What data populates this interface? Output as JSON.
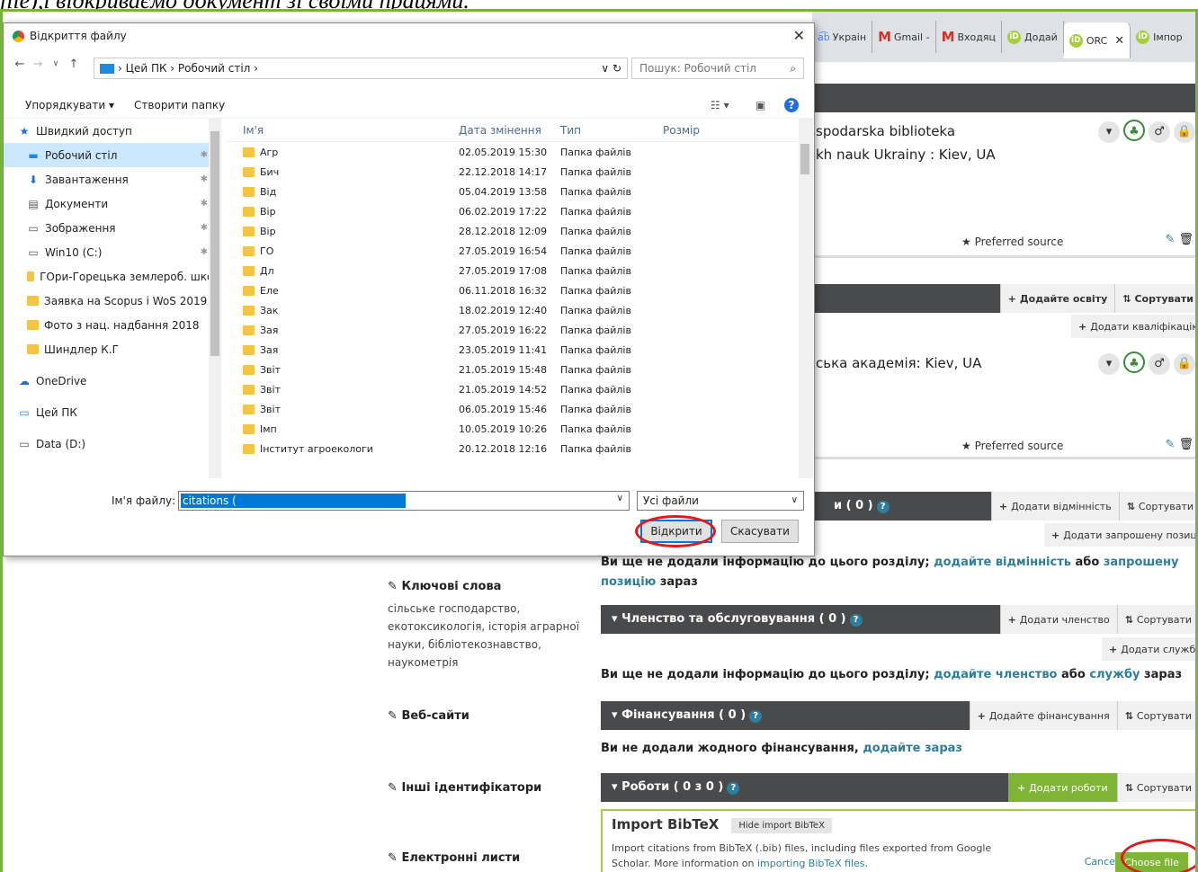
{
  "caption": "file),і відкриваємо документ зі своїми працями.",
  "browser_tabs": [
    "Украін",
    "Gmail -",
    "Входяц",
    "Додай",
    "ORC",
    "Імпор"
  ],
  "orcid": {
    "employment_card": {
      "title_line1": "spodarska biblioteka",
      "title_line2": "kh nauk Ukrainy : Kiev, UA",
      "preferred": "Preferred source"
    },
    "education_bar": {
      "add_label": "Додайте освіту",
      "sort_label": "Сортувати",
      "qual_label": "Додати кваліфікацію"
    },
    "education_card": {
      "title": "ська академія: Kiev, UA",
      "preferred": "Preferred source"
    },
    "sections": [
      {
        "title": "и ( 0 )",
        "add": "Додати відмінність",
        "sort": "Сортувати",
        "sub": "Додати запрошену позицію"
      },
      {
        "title": "Членство та обслуговування ( 0 )",
        "add": "Додати членство",
        "sort": "Сортувати",
        "sub": "Додати службу"
      },
      {
        "title": "Фінансування ( 0 )",
        "add": "Додайте фінансування",
        "sort": "Сортувати"
      },
      {
        "title": "Роботи ( 0 з 0 )",
        "add": "Додати роботи",
        "sort": "Сортувати"
      }
    ],
    "notes": {
      "awards": {
        "pre": "Ви ще не додали інформацію до цього розділу; ",
        "link1": "додайте відмінність",
        "mid": " або ",
        "link2": "запрошену позицію",
        "post": " зараз"
      },
      "membership": {
        "pre": "Ви ще не додали інформацію до цього розділу; ",
        "link1": "додайте членство",
        "mid": " або ",
        "link2": "службу",
        "post": " зараз"
      },
      "funding": {
        "pre": "Ви не додали жодного фінансування, ",
        "link1": "додайте зараз"
      }
    },
    "sidebar": {
      "keywords_label": "Ключові слова",
      "keywords_lines": [
        "сільське господарство,",
        "екотоксикологія, історія аграрної",
        "науки, бібліотекознавство,",
        "наукометрія"
      ],
      "websites_label": "Веб-сайти",
      "other_ids_label": "Інші ідентифікатори",
      "emails_label": "Електронні листи"
    },
    "import": {
      "title": "Import BibTeX",
      "hide": "Hide import BibTeX",
      "desc_line1": "Import citations from BibTeX (.bib) files, including files exported from Google",
      "desc_pre": "Scholar. More information on ",
      "desc_link": "importing BibTeX files",
      "desc_post": ".",
      "cancel": "Cancel",
      "choose": "Choose file"
    }
  },
  "dialog": {
    "title": "Відкриття файлу",
    "path": [
      "Цей ПК",
      "Робочий стіл"
    ],
    "search_placeholder": "Пошук: Робочий стіл",
    "organize": "Упорядкувати ▾",
    "new_folder": "Створити папку",
    "nav": [
      {
        "label": "Швидкий доступ",
        "icon": "star-icon"
      },
      {
        "label": "Робочий стіл",
        "icon": "desktop-icon",
        "selected": true,
        "pinned": true
      },
      {
        "label": "Завантаження",
        "icon": "download-icon",
        "pinned": true
      },
      {
        "label": "Документи",
        "icon": "document-icon",
        "pinned": true
      },
      {
        "label": "Зображення",
        "icon": "image-icon",
        "pinned": true
      },
      {
        "label": "Win10 (C:)",
        "icon": "drive-icon",
        "pinned": true
      },
      {
        "label": "ГОри-Горецька землероб. школ",
        "icon": "folder-icon"
      },
      {
        "label": "Заявка на Scopus і WoS 2019",
        "icon": "folder-icon"
      },
      {
        "label": "Фото з нац. надбання 2018",
        "icon": "folder-icon"
      },
      {
        "label": "Шиндлер К.Г",
        "icon": "folder-icon"
      },
      {
        "label": "OneDrive",
        "icon": "cloud-icon"
      },
      {
        "label": "Цей ПК",
        "icon": "pc-icon"
      },
      {
        "label": "Data (D:)",
        "icon": "drive-icon"
      }
    ],
    "columns": [
      "Ім'я",
      "Дата змінення",
      "Тип",
      "Розмір"
    ],
    "files": [
      {
        "name": "Агр",
        "date": "02.05.2019 15:30",
        "type": "Папка файлів"
      },
      {
        "name": "Бич",
        "date": "22.12.2018 14:17",
        "type": "Папка файлів"
      },
      {
        "name": "Від",
        "date": "05.04.2019 13:58",
        "type": "Папка файлів"
      },
      {
        "name": "Вір",
        "date": "06.02.2019 17:22",
        "type": "Папка файлів"
      },
      {
        "name": "Вір",
        "date": "28.12.2018 12:09",
        "type": "Папка файлів"
      },
      {
        "name": "ГО",
        "date": "27.05.2019 16:54",
        "type": "Папка файлів"
      },
      {
        "name": "Дл",
        "date": "27.05.2019 17:08",
        "type": "Папка файлів"
      },
      {
        "name": "Еле",
        "date": "06.11.2018 16:32",
        "type": "Папка файлів"
      },
      {
        "name": "Зак",
        "date": "18.02.2019 12:40",
        "type": "Папка файлів"
      },
      {
        "name": "Зая",
        "date": "27.05.2019 16:22",
        "type": "Папка файлів"
      },
      {
        "name": "Зая",
        "date": "23.05.2019 11:41",
        "type": "Папка файлів"
      },
      {
        "name": "Звіт",
        "date": "21.05.2019 15:48",
        "type": "Папка файлів"
      },
      {
        "name": "Звіт",
        "date": "21.05.2019 14:52",
        "type": "Папка файлів"
      },
      {
        "name": "Звіт",
        "date": "06.05.2019 15:46",
        "type": "Папка файлів"
      },
      {
        "name": "Імп",
        "date": "10.05.2019 10:26",
        "type": "Папка файлів"
      },
      {
        "name": "Інститут агроекологи",
        "date": "20.12.2018 12:16",
        "type": "Папка файлів"
      }
    ],
    "filename_label": "Ім'я файлу:",
    "filename_value": "citations (",
    "filter": "Усі файли",
    "open": "Відкрити",
    "cancel": "Скасувати"
  }
}
